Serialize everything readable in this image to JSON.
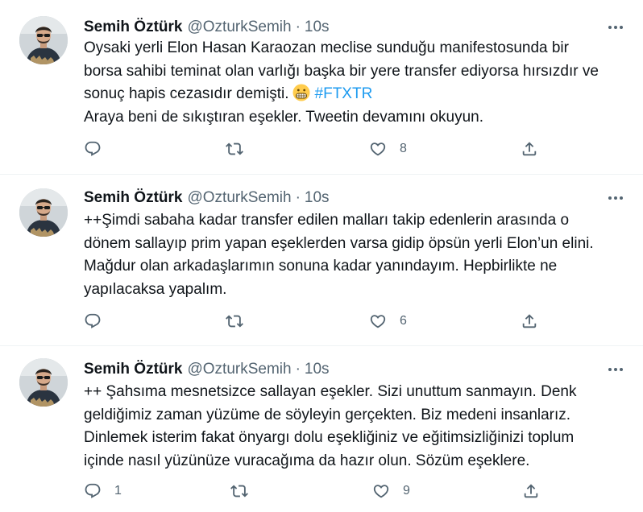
{
  "colors": {
    "text": "#0f1419",
    "secondary": "#536471",
    "link": "#1d9bf0",
    "divider": "#eff3f4"
  },
  "tweets": [
    {
      "name": "Semih Öztürk",
      "handle": "@OzturkSemih",
      "separator": "·",
      "time": "10s",
      "text_before": "Oysaki yerli Elon Hasan Karaozan meclise sunduğu manifestosunda bir\nborsa sahibi teminat olan varlığı başka bir yere transfer ediyorsa hırsızdır ve\nsonuç hapis cezasıdır demişti.",
      "emoji": "grimacing-face",
      "hashtag": "#FTXTR",
      "text_after": "Araya beni de sıkıştıran eşekler. Tweetin devamını okuyun.",
      "replies": "",
      "retweets": "",
      "likes": "8"
    },
    {
      "name": "Semih Öztürk",
      "handle": "@OzturkSemih",
      "separator": "·",
      "time": "10s",
      "text": "++Şimdi sabaha kadar transfer edilen malları takip edenlerin arasında o\ndönem sallayıp prim yapan eşeklerden varsa gidip öpsün yerli Elon’un elini.\nMağdur olan arkadaşlarımın sonuna kadar yanındayım. Hepbirlikte ne\nyapılacaksa yapalım.",
      "replies": "",
      "retweets": "",
      "likes": "6"
    },
    {
      "name": "Semih Öztürk",
      "handle": "@OzturkSemih",
      "separator": "·",
      "time": "10s",
      "text": "++ Şahsıma mesnetsizce sallayan eşekler. Sizi unuttum sanmayın. Denk\ngeldiğimiz zaman yüzüme de söyleyin gerçekten. Biz medeni insanlarız.\nDinlemek isterim fakat önyargı dolu eşekliğiniz ve eğitimsizliğinizi toplum\niçinde nasıl yüzünüze vuracağıma da hazır olun. Sözüm eşeklere.",
      "replies": "1",
      "retweets": "",
      "likes": "9"
    }
  ]
}
